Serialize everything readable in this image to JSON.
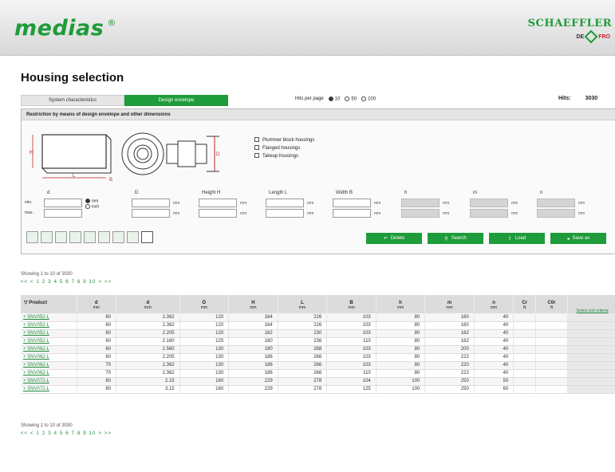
{
  "header": {
    "logo_text": "medias",
    "logo_mark": "®",
    "brand": "SCHAEFFLER",
    "lang_de": "DE",
    "lang_fr": "FRO"
  },
  "page_title": "Housing selection",
  "tabs": [
    {
      "label": "System characteristics",
      "active": false
    },
    {
      "label": "Design envelope",
      "active": true
    }
  ],
  "hits_per_page": {
    "label": "Hits per page",
    "options": [
      "10",
      "50",
      "100"
    ],
    "selected": "10"
  },
  "hits": {
    "label": "Hits:",
    "value": "3030"
  },
  "panel_title": "Restriction by means of design envelope and other dimensions",
  "housing_types": [
    "Plummer block housings",
    "Flanged housings",
    "Takeup housings"
  ],
  "fields": [
    {
      "label": "d",
      "unit": "mm",
      "grey": false
    },
    {
      "label": "D",
      "unit": "mm",
      "grey": false
    },
    {
      "label": "Height H",
      "unit": "mm",
      "grey": false
    },
    {
      "label": "Length L",
      "unit": "mm",
      "grey": false
    },
    {
      "label": "Width B",
      "unit": "mm",
      "grey": false
    },
    {
      "label": "h",
      "unit": "mm",
      "grey": true
    },
    {
      "label": "m",
      "unit": "mm",
      "grey": true
    },
    {
      "label": "n",
      "unit": "mm",
      "grey": true
    }
  ],
  "row_labels": {
    "min": "min.",
    "max": "max."
  },
  "unit_toggle": {
    "mm": "mm",
    "inch": "inch",
    "selected": "mm"
  },
  "buttons": [
    "Delete",
    "Search",
    "Load",
    "Save as"
  ],
  "showing_text": "Showing 1 to 10 of 3030",
  "pager": [
    "<<",
    "<",
    "1",
    "2",
    "3",
    "4",
    "5",
    "6",
    "7",
    "8",
    "9",
    "10",
    ">",
    ">>"
  ],
  "table": {
    "headers": [
      "Product",
      "d",
      "d",
      "D",
      "H",
      "L",
      "B",
      "h",
      "m",
      "n",
      "Cr",
      "C0r"
    ],
    "units": [
      "",
      "mm",
      "inch",
      "mm",
      "mm",
      "mm",
      "mm",
      "mm",
      "mm",
      "mm",
      "N",
      "N"
    ],
    "sort_link": "Select sort criteria",
    "rows": [
      [
        "+ SNV052-L",
        "60",
        "2.362",
        "120",
        "164",
        "226",
        "103",
        "80",
        "160",
        "40"
      ],
      [
        "+ SNV052-L",
        "60",
        "2.362",
        "120",
        "164",
        "226",
        "103",
        "80",
        "160",
        "40"
      ],
      [
        "+ SNV052-L",
        "60",
        "2.205",
        "120",
        "162",
        "230",
        "103",
        "80",
        "162",
        "40"
      ],
      [
        "+ SNV052-L",
        "60",
        "2.160",
        "125",
        "160",
        "236",
        "110",
        "80",
        "162",
        "40"
      ],
      [
        "+ SNV062-L",
        "60",
        "2.560",
        "130",
        "190",
        "268",
        "103",
        "80",
        "200",
        "40"
      ],
      [
        "+ SNV062-L",
        "60",
        "2.205",
        "130",
        "186",
        "266",
        "103",
        "80",
        "222",
        "40"
      ],
      [
        "+ SNV062-L",
        "70",
        "2.362",
        "130",
        "186",
        "266",
        "103",
        "80",
        "220",
        "40"
      ],
      [
        "+ SNV062-L",
        "70",
        "2.362",
        "130",
        "186",
        "266",
        "110",
        "80",
        "222",
        "40"
      ],
      [
        "+ SNV072-L",
        "80",
        "2.15",
        "160",
        "229",
        "278",
        "104",
        "100",
        "250",
        "50"
      ],
      [
        "+ SNV072-L",
        "80",
        "3.15",
        "160",
        "229",
        "278",
        "125",
        "100",
        "250",
        "60"
      ]
    ]
  }
}
